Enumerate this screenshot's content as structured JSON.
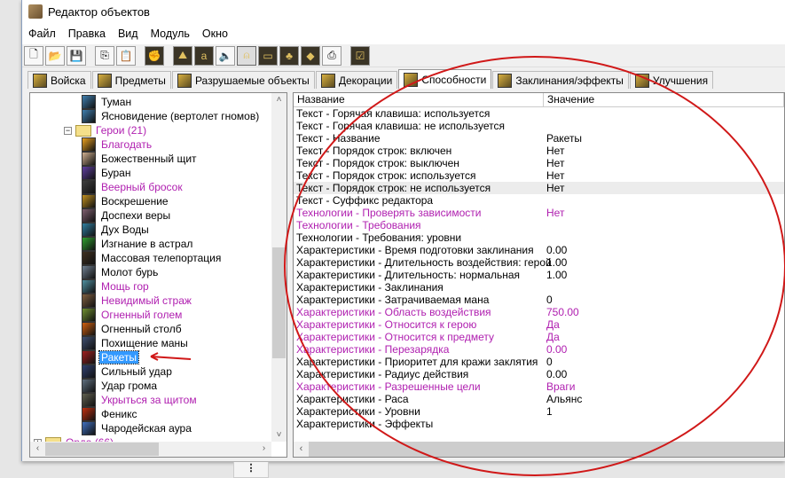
{
  "window": {
    "title": "Редактор объектов"
  },
  "menu": [
    "Файл",
    "Правка",
    "Вид",
    "Модуль",
    "Окно"
  ],
  "toolbar": [
    "new-icon",
    "open-icon",
    "save-icon",
    "copy-icon",
    "paste-icon",
    "abilities-icon",
    "terrain-icon",
    "text-icon",
    "sound-icon",
    "units-icon",
    "items-icon",
    "destructibles-icon",
    "doodads-icon",
    "import-icon",
    "test-map-icon"
  ],
  "tabs": [
    {
      "label": "Войска"
    },
    {
      "label": "Предметы"
    },
    {
      "label": "Разрушаемые объекты"
    },
    {
      "label": "Декорации"
    },
    {
      "label": "Способности",
      "active": true
    },
    {
      "label": "Заклинания/эффекты"
    },
    {
      "label": "Улучшения"
    }
  ],
  "tree": {
    "pre": [
      {
        "label": "Туман"
      },
      {
        "label": "Ясновидение (вертолет гномов)"
      }
    ],
    "folder": {
      "label": "Герои (21)",
      "modified": true
    },
    "items": [
      {
        "label": "Благодать",
        "modified": true,
        "color": "#e8a020"
      },
      {
        "label": "Божественный щит",
        "color": "#d0b090"
      },
      {
        "label": "Буран",
        "color": "#6040a0"
      },
      {
        "label": "Веерный бросок",
        "modified": true,
        "color": "#404040"
      },
      {
        "label": "Воскрешение",
        "color": "#c09020"
      },
      {
        "label": "Доспехи веры",
        "color": "#806070"
      },
      {
        "label": "Дух Воды",
        "color": "#3080a0"
      },
      {
        "label": "Изгнание в астрал",
        "color": "#30a030"
      },
      {
        "label": "Массовая телепортация",
        "color": "#403020"
      },
      {
        "label": "Молот бурь",
        "color": "#708090"
      },
      {
        "label": "Мощь гор",
        "modified": true,
        "color": "#5090a0"
      },
      {
        "label": "Невидимый страж",
        "modified": true,
        "color": "#806040"
      },
      {
        "label": "Огненный голем",
        "modified": true,
        "color": "#709030"
      },
      {
        "label": "Огненный столб",
        "color": "#d06010"
      },
      {
        "label": "Похищение маны",
        "color": "#405070"
      },
      {
        "label": "Ракеты",
        "selected": true,
        "color": "#a02020"
      },
      {
        "label": "Сильный удар",
        "color": "#304070"
      },
      {
        "label": "Удар грома",
        "color": "#607080"
      },
      {
        "label": "Укрыться за щитом",
        "modified": true,
        "color": "#606050"
      },
      {
        "label": "Феникс",
        "color": "#c03010"
      },
      {
        "label": "Чародейская аура",
        "color": "#4070c0"
      }
    ],
    "post": {
      "label": "Орда (66)",
      "modified": true
    }
  },
  "props": {
    "headers": [
      "Название",
      "Значение"
    ],
    "rows": [
      {
        "name": "Текст - Горячая клавиша: используется",
        "value": ""
      },
      {
        "name": "Текст - Горячая клавиша: не используется",
        "value": ""
      },
      {
        "name": "Текст - Название",
        "value": "Ракеты"
      },
      {
        "name": "Текст - Порядок строк: включен",
        "value": "Нет"
      },
      {
        "name": "Текст - Порядок строк: выключен",
        "value": "Нет"
      },
      {
        "name": "Текст - Порядок строк: используется",
        "value": "Нет"
      },
      {
        "name": "Текст - Порядок строк: не используется",
        "value": "Нет",
        "hl": true
      },
      {
        "name": "Текст - Суффикс редактора",
        "value": ""
      },
      {
        "name": "Технологии - Проверять зависимости",
        "value": "Нет",
        "modified": true
      },
      {
        "name": "Технологии - Требования",
        "value": "",
        "modified": true
      },
      {
        "name": "Технологии - Требования: уровни",
        "value": ""
      },
      {
        "name": "Характеристики - Время подготовки заклинания",
        "value": "0.00"
      },
      {
        "name": "Характеристики - Длительность воздействия: герой",
        "value": "1.00"
      },
      {
        "name": "Характеристики - Длительность: нормальная",
        "value": "1.00"
      },
      {
        "name": "Характеристики - Заклинания",
        "value": ""
      },
      {
        "name": "Характеристики - Затрачиваемая мана",
        "value": "0"
      },
      {
        "name": "Характеристики - Область воздействия",
        "value": "750.00",
        "modified": true
      },
      {
        "name": "Характеристики - Относится к герою",
        "value": "Да",
        "modified": true
      },
      {
        "name": "Характеристики - Относится к предмету",
        "value": "Да",
        "modified": true
      },
      {
        "name": "Характеристики - Перезарядка",
        "value": "0.00",
        "modified": true
      },
      {
        "name": "Характеристики - Приоритет для кражи заклятия",
        "value": "0"
      },
      {
        "name": "Характеристики - Радиус действия",
        "value": "0.00"
      },
      {
        "name": "Характеристики - Разрешенные цели",
        "value": "Враги",
        "modified": true
      },
      {
        "name": "Характеристики - Раса",
        "value": "Альянс"
      },
      {
        "name": "Характеристики - Уровни",
        "value": "1"
      },
      {
        "name": "Характеристики - Эффекты",
        "value": ""
      }
    ]
  },
  "colors": {
    "modified": "#b020b0",
    "annotation": "#d01818",
    "selection": "#3399ff"
  }
}
